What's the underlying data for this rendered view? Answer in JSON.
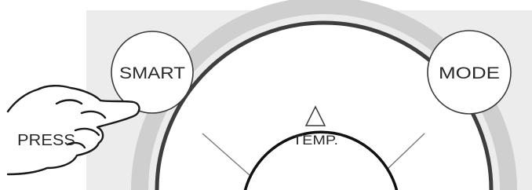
{
  "remote": {
    "smart_button_label": "SMART",
    "mode_button_label": "MODE",
    "temp_label": "TEMP.",
    "temp_up_symbol": "△"
  },
  "instruction": {
    "press_label": "PRESS"
  },
  "colors": {
    "panel": "#ececec",
    "button_fill": "#ffffff",
    "outline": "#333333",
    "dial_ring": "#cfcfcf",
    "dial_edge": "#444444"
  },
  "icons": {
    "hand": "pointing-hand-icon",
    "temp_up": "triangle-up-icon"
  }
}
